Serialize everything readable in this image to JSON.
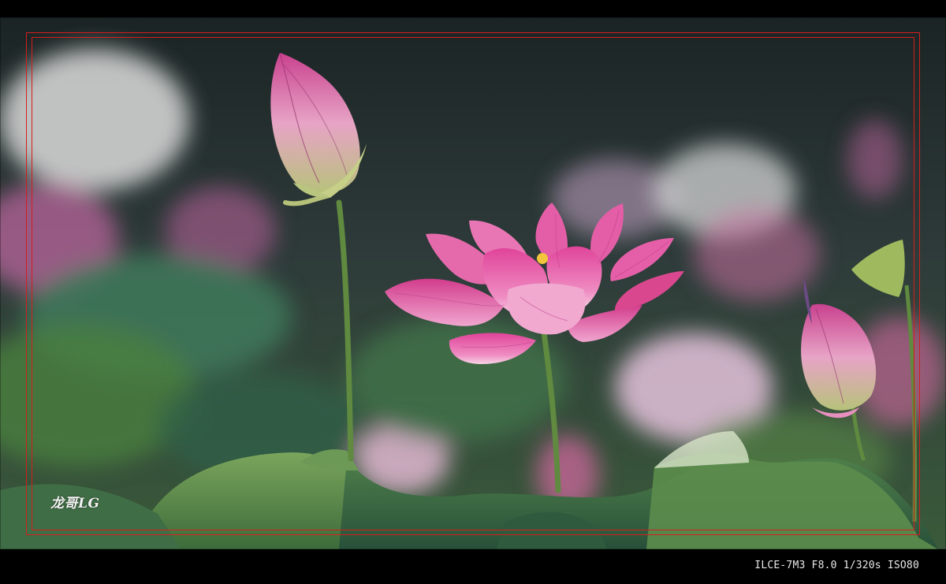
{
  "photo": {
    "subject": "pink-lotus-flowers",
    "colors": {
      "petal_pink": "#e2489a",
      "petal_light": "#f6c9e0",
      "leaf_green": "#5b8f4c",
      "dark_bg": "#1d2a28",
      "frame_red": "#d41e1e"
    }
  },
  "watermark": {
    "text": "龙哥LG"
  },
  "exif": {
    "text": "ILCE-7M3 F8.0 1/320s ISO80"
  }
}
